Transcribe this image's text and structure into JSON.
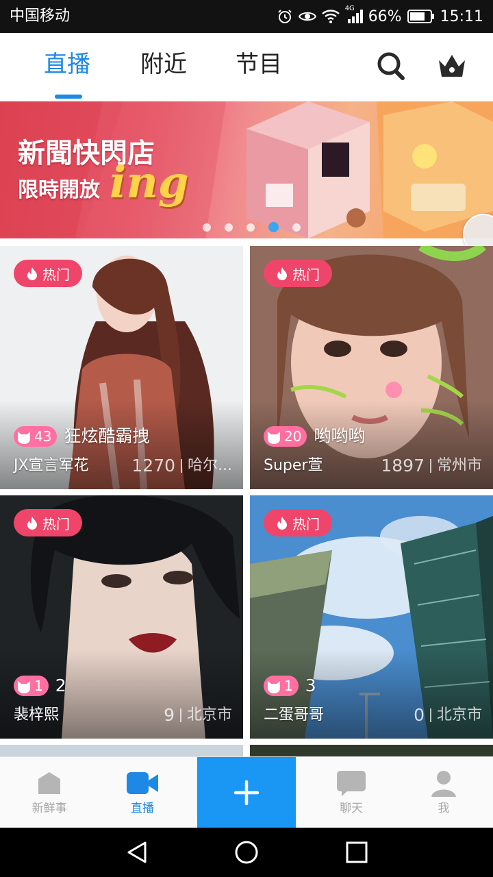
{
  "status_bar": {
    "carrier": "中国移动",
    "network": "4G",
    "battery": "66%",
    "time": "15:11"
  },
  "top_nav": {
    "tabs": [
      {
        "label": "直播",
        "active": true
      },
      {
        "label": "附近",
        "active": false
      },
      {
        "label": "节目",
        "active": false
      }
    ],
    "icons": [
      "search-icon",
      "crown-icon"
    ],
    "accent_color": "#1e88e5"
  },
  "banner": {
    "title": "新聞快閃店",
    "subtitle": "限時開放",
    "highlight": "ing",
    "page_count": 5,
    "active_page": 4
  },
  "streams": [
    {
      "badge": "热门",
      "level": "43",
      "title": "狂炫酷霸拽",
      "streamer": "JX宣言军花",
      "viewers": "1270",
      "location": "哈尔..."
    },
    {
      "badge": "热门",
      "level": "20",
      "title": "哟哟哟",
      "streamer": "Super萱",
      "viewers": "1897",
      "location": "常州市"
    },
    {
      "badge": "热门",
      "level": "1",
      "title": "2",
      "streamer": "裴梓熙",
      "viewers": "9",
      "location": "北京市"
    },
    {
      "badge": "热门",
      "level": "1",
      "title": "3",
      "streamer": "二蛋哥哥",
      "viewers": "0",
      "location": "北京市"
    }
  ],
  "bottom_nav": {
    "items": [
      {
        "label": "新鲜事",
        "icon": "home-icon",
        "active": false
      },
      {
        "label": "直播",
        "icon": "video-camera-icon",
        "active": true
      },
      {
        "label": "聊天",
        "icon": "chat-bubble-icon",
        "active": false
      },
      {
        "label": "我",
        "icon": "person-icon",
        "active": false
      }
    ],
    "create_icon": "plus-icon",
    "create_color": "#1a96f5"
  },
  "system_nav": [
    "back-icon",
    "home-circle-icon",
    "recents-icon"
  ]
}
